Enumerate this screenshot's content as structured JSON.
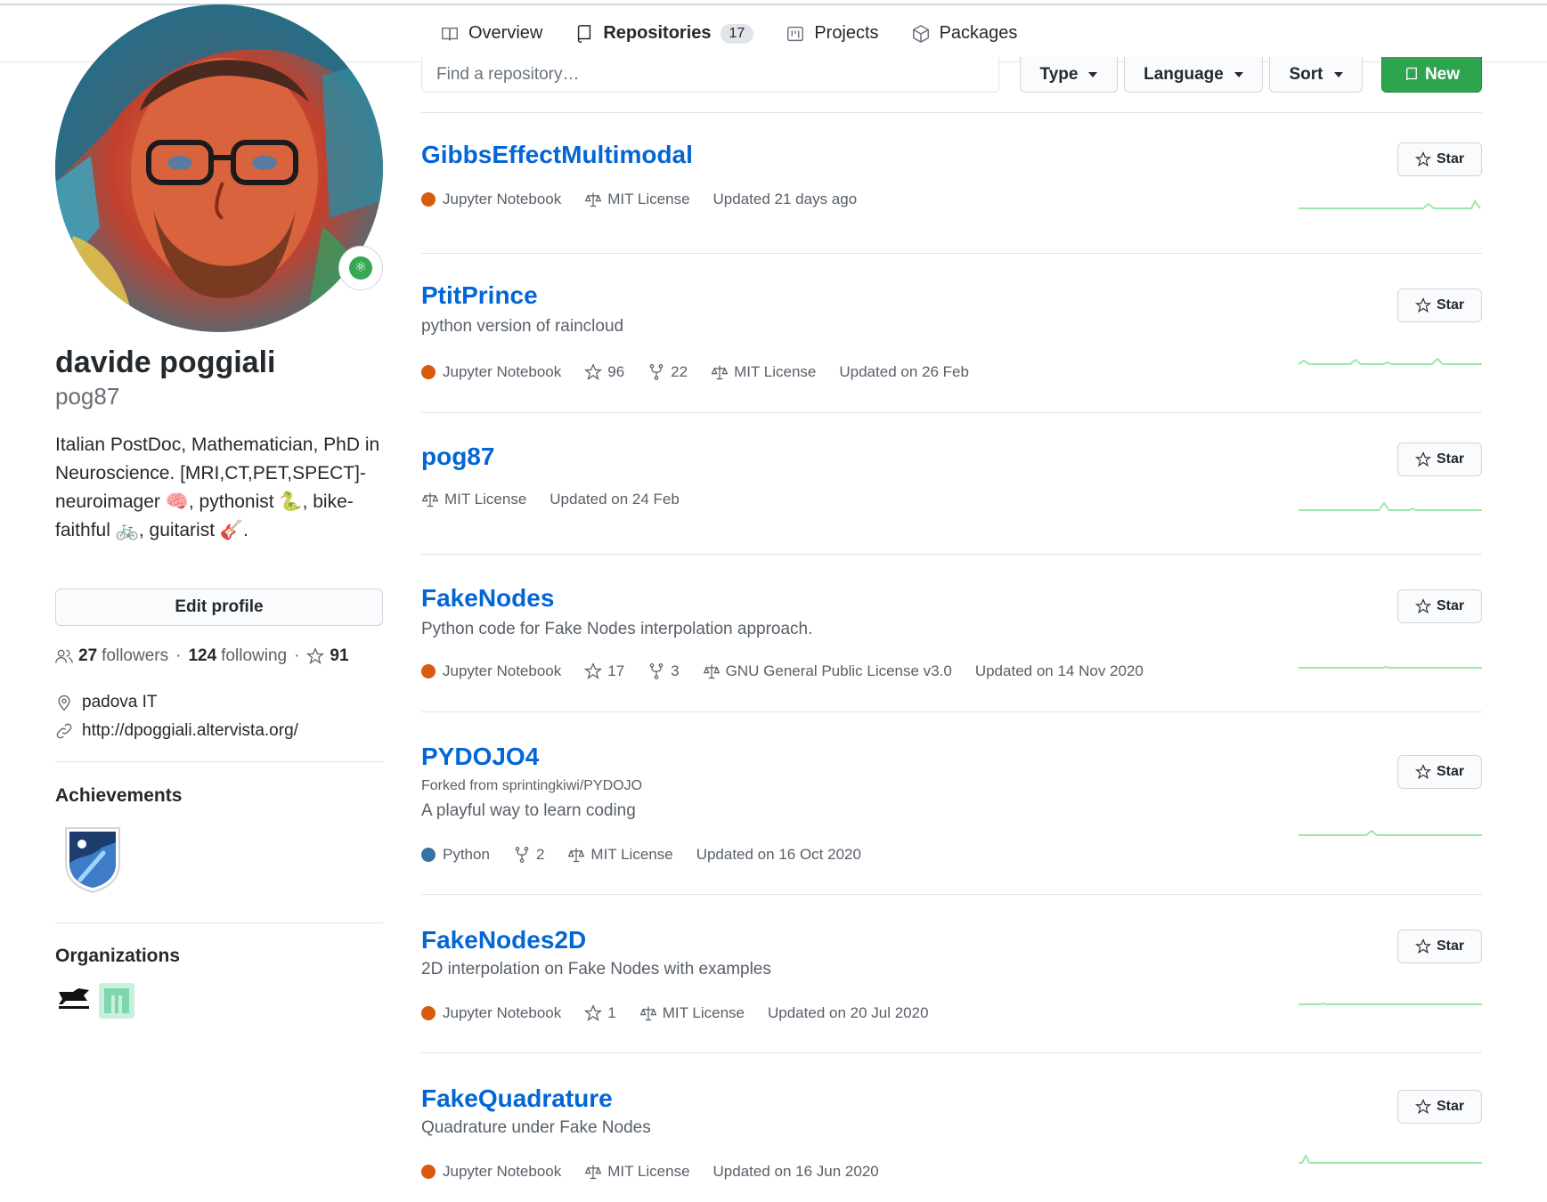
{
  "tabs": [
    {
      "label": "Overview",
      "icon": "book-icon"
    },
    {
      "label": "Repositories",
      "icon": "repo-icon",
      "counter": "17"
    },
    {
      "label": "Projects",
      "icon": "project-icon"
    },
    {
      "label": "Packages",
      "icon": "package-icon"
    }
  ],
  "profile": {
    "fullname": "davide poggiali",
    "username": "pog87",
    "bio": "Italian PostDoc, Mathematician, PhD in Neuroscience. [MRI,CT,PET,SPECT]-neuroimager 🧠, pythonist 🐍, bike-faithful 🚲, guitarist 🎸.",
    "edit_label": "Edit profile",
    "followers_count": "27",
    "followers_label": "followers",
    "following_count": "124",
    "following_label": "following",
    "stars_count": "91",
    "location": "padova IT",
    "website": "http://dpoggiali.altervista.org/"
  },
  "sections": {
    "achievements": "Achievements",
    "organizations": "Organizations"
  },
  "filters": {
    "search_placeholder": "Find a repository…",
    "type_label": "Type",
    "language_label": "Language",
    "sort_label": "Sort",
    "new_label": "New"
  },
  "colors": {
    "link": "#0366d6",
    "jupyter": "#DA5B0B",
    "python": "#3572A5",
    "new_button": "#2ea44f",
    "tab_underline": "#f9826c"
  },
  "star_label": "Star",
  "repos": [
    {
      "name": "GibbsEffectMultimodal",
      "language": "Jupyter Notebook",
      "license": "MIT License",
      "updated": "Updated 21 days ago"
    },
    {
      "name": "PtitPrince",
      "description": "python version of raincloud",
      "language": "Jupyter Notebook",
      "stars": "96",
      "forks": "22",
      "license": "MIT License",
      "updated": "Updated on 26 Feb"
    },
    {
      "name": "pog87",
      "license": "MIT License",
      "updated": "Updated on 24 Feb"
    },
    {
      "name": "FakeNodes",
      "description": "Python code for Fake Nodes interpolation approach.",
      "language": "Jupyter Notebook",
      "stars": "17",
      "forks": "3",
      "license": "GNU General Public License v3.0",
      "updated": "Updated on 14 Nov 2020"
    },
    {
      "name": "PYDOJO4",
      "fork_note": "Forked from sprintingkiwi/PYDOJO",
      "description": "A playful way to learn coding",
      "language": "Python",
      "forks": "2",
      "license": "MIT License",
      "updated": "Updated on 16 Oct 2020"
    },
    {
      "name": "FakeNodes2D",
      "description": "2D interpolation on Fake Nodes with examples",
      "language": "Jupyter Notebook",
      "stars": "1",
      "license": "MIT License",
      "updated": "Updated on 20 Jul 2020"
    },
    {
      "name": "FakeQuadrature",
      "description": "Quadrature under Fake Nodes",
      "language": "Jupyter Notebook",
      "license": "MIT License",
      "updated": "Updated on 16 Jun 2020"
    }
  ]
}
